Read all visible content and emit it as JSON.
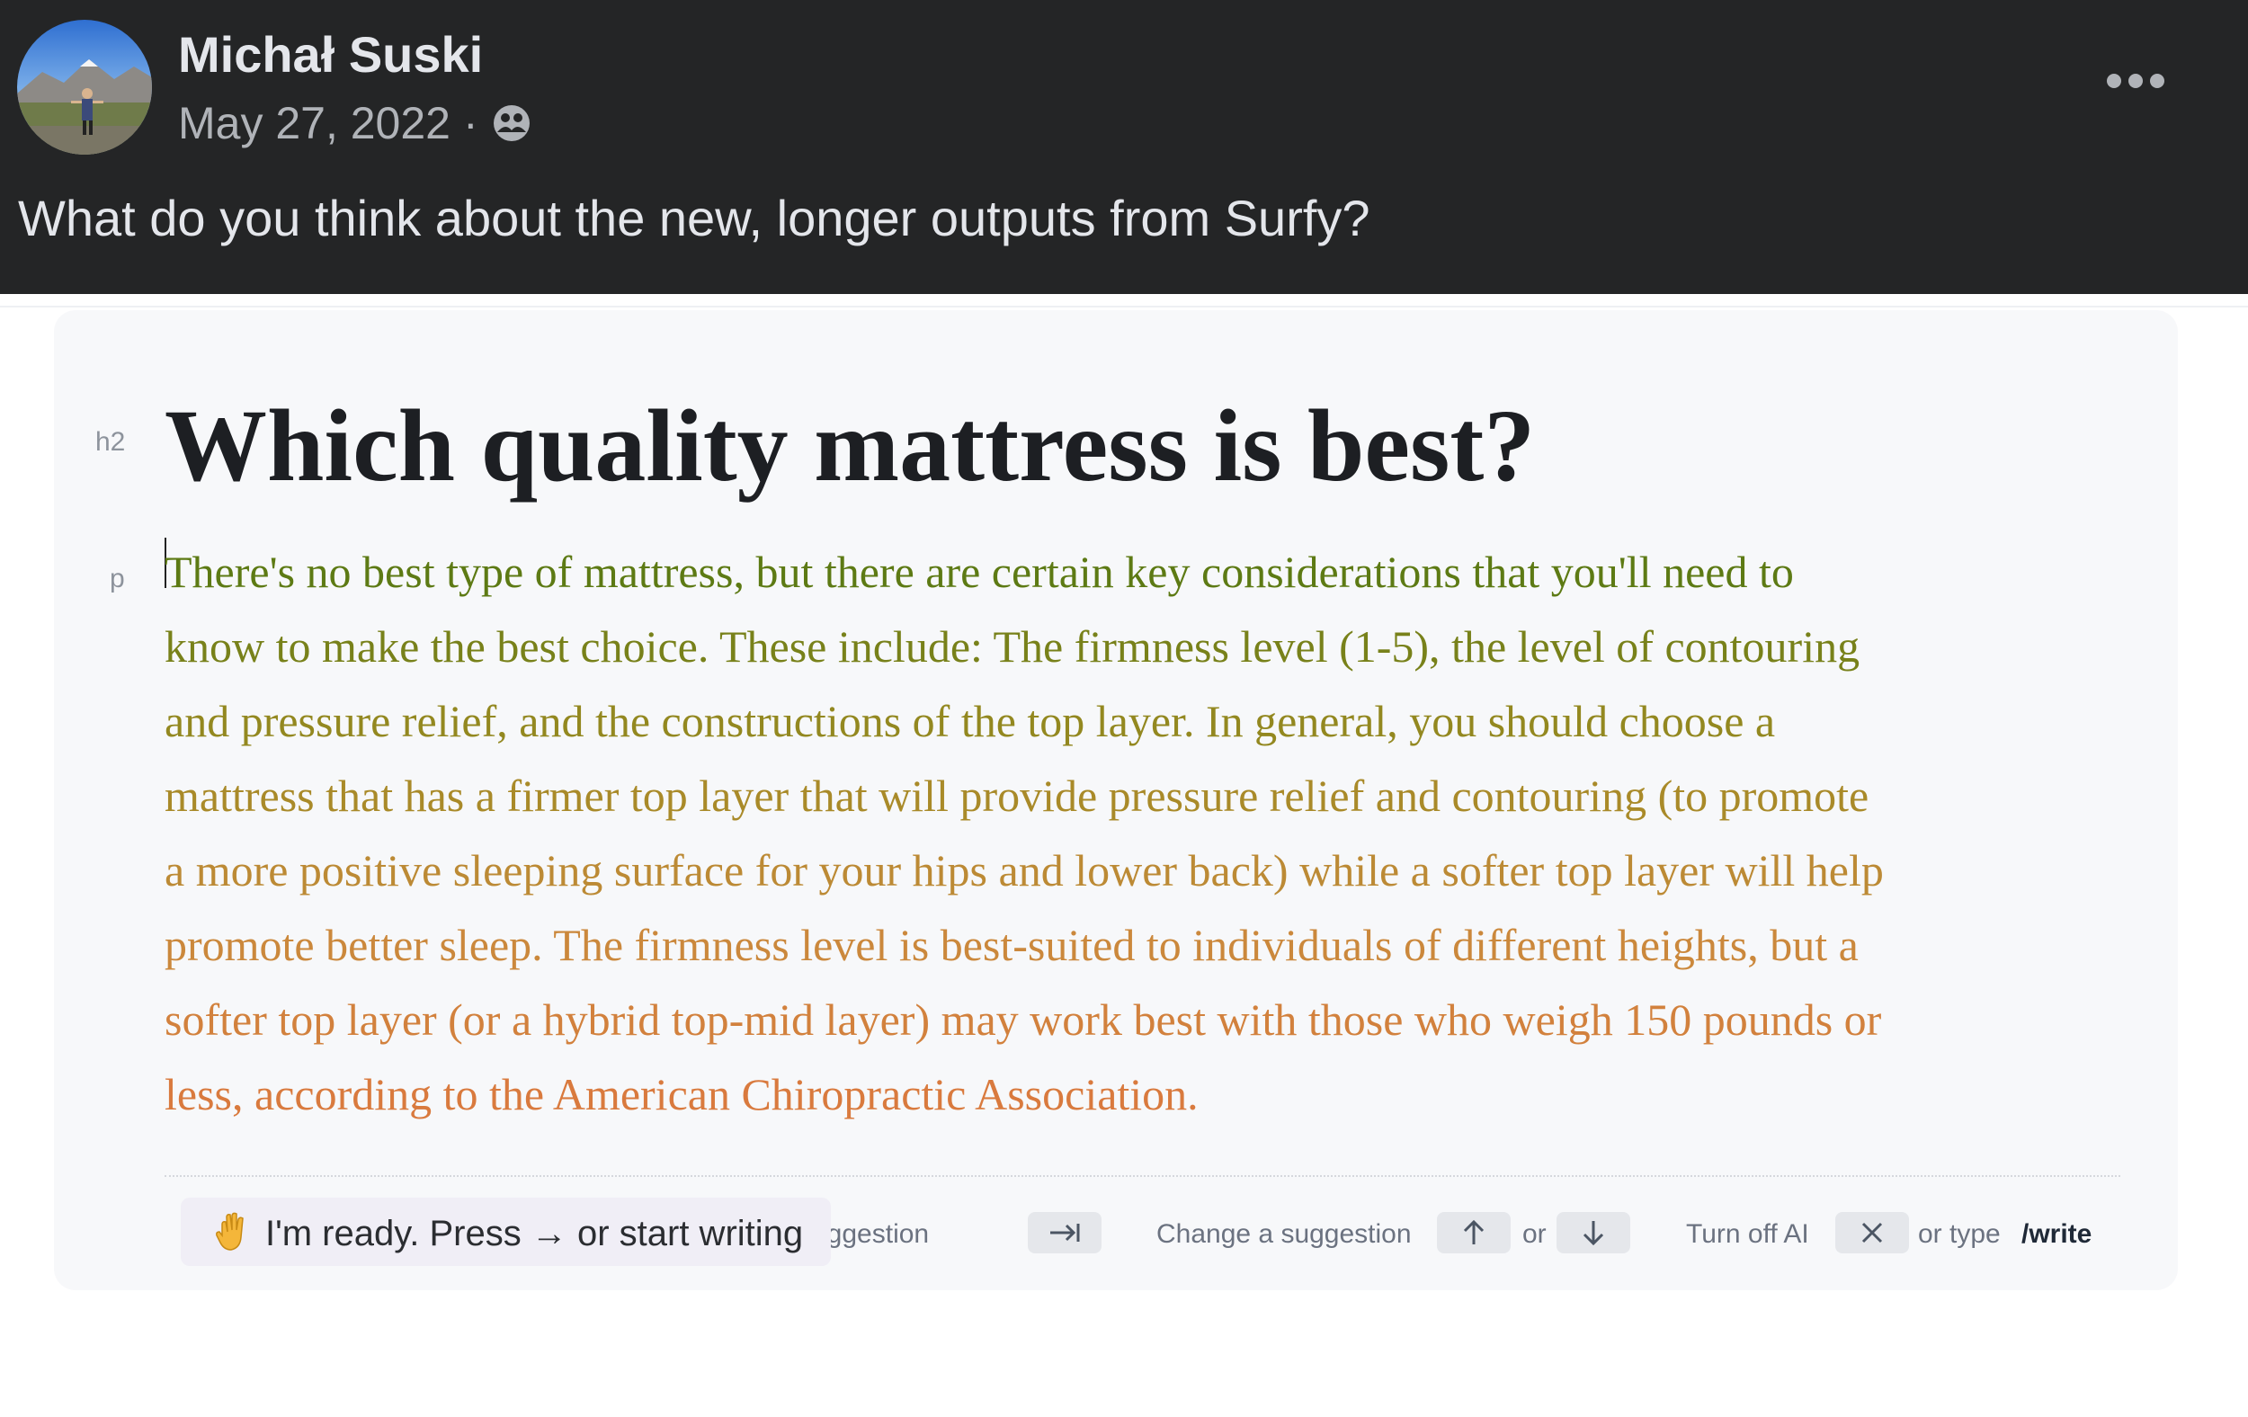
{
  "post": {
    "author": "Michał Suski",
    "date": "May 27, 2022",
    "separator": "·",
    "audience_icon": "friends-icon",
    "text": "What do you think about the new, longer outputs from Surfy?",
    "more_icon": "ellipsis-icon"
  },
  "editor": {
    "heading_tag": "h2",
    "paragraph_tag": "p",
    "heading": "Which quality mattress is best?",
    "paragraph_lines": [
      "There's no best type of mattress, but there are certain key considerations that you'll need to",
      "know to make the best choice. These include: The firmness level (1-5), the level of contouring",
      "and pressure relief, and the constructions of the top layer. In general, you should choose a",
      "mattress that has a firmer top layer that will provide pressure relief and contouring (to promote",
      "a more positive sleeping surface for your hips and lower back) while a softer top layer will help",
      "promote better sleep. The firmness level is best-suited to individuals of different heights, but a",
      "softer top layer (or a hybrid top-mid layer) may work best with those who weigh 150 pounds or",
      "less, according to the American Chiropractic Association."
    ],
    "paragraph_gradient": [
      "#5d7a14",
      "#9c8a22",
      "#c98a3c",
      "#d97a3e"
    ]
  },
  "hints": {
    "ready": "I'm ready. Press → or start writing",
    "hand_icon": "waving-hand-icon",
    "accept_partial": "uggestion",
    "change": "Change a suggestion",
    "or1": "or",
    "turn_off": "Turn off AI",
    "or_type": "or type",
    "write_command": "/write"
  }
}
